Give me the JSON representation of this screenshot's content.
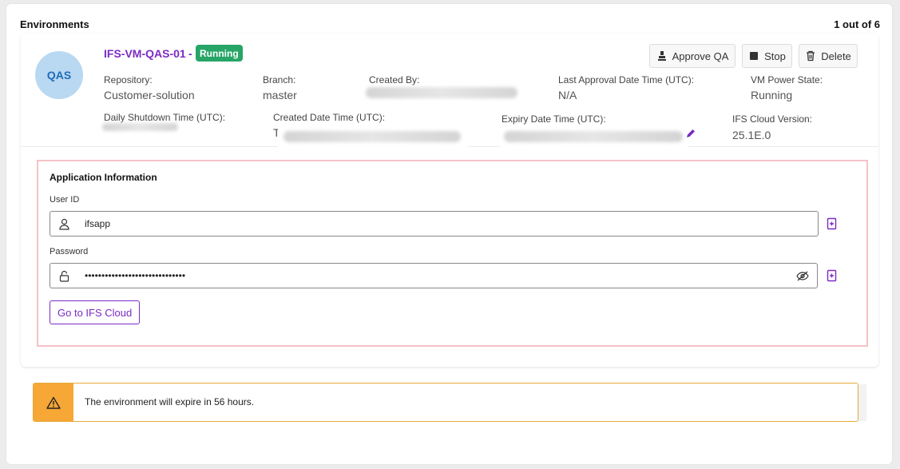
{
  "header": {
    "title": "Environments",
    "count": "1 out of 6"
  },
  "environment": {
    "avatar": "QAS",
    "name": "IFS-VM-QAS-01",
    "separator": "-",
    "status": "Running",
    "actions": {
      "approve": "Approve QA",
      "stop": "Stop",
      "delete": "Delete"
    },
    "fields": {
      "repository": {
        "label": "Repository:",
        "value": "Customer-solution"
      },
      "branch": {
        "label": "Branch:",
        "value": "master"
      },
      "created_by": {
        "label": "Created By:"
      },
      "last_approval": {
        "label": "Last Approval Date Time (UTC):",
        "value": "N/A"
      },
      "vm_power_state": {
        "label": "VM Power State:",
        "value": "Running"
      },
      "daily_shutdown": {
        "label": "Daily Shutdown Time (UTC):"
      },
      "created_date": {
        "label": "Created Date Time (UTC):",
        "value": "T"
      },
      "expiry_date": {
        "label": "Expiry Date Time (UTC):"
      },
      "ifs_cloud_version": {
        "label": "IFS Cloud Version:",
        "value": "25.1E.0"
      }
    }
  },
  "application": {
    "title": "Application Information",
    "user_id": {
      "label": "User ID",
      "value": "ifsapp"
    },
    "password": {
      "label": "Password",
      "value": "••••••••••••••••••••••••••••••"
    },
    "go_button": "Go to IFS Cloud"
  },
  "warning": {
    "text": "The environment will expire in 56 hours."
  },
  "icons": {
    "approve": "stamp-icon",
    "stop": "stop-icon",
    "delete": "trash-icon",
    "user": "user-icon",
    "lock": "lock-icon",
    "eye": "eye-off-icon",
    "copy": "copy-icon",
    "edit": "pencil-icon",
    "warning": "warning-icon"
  },
  "colors": {
    "accent": "#7a2bc4",
    "running": "#27a567",
    "warning": "#f7a735",
    "avatar_bg": "#b9d8f2"
  }
}
